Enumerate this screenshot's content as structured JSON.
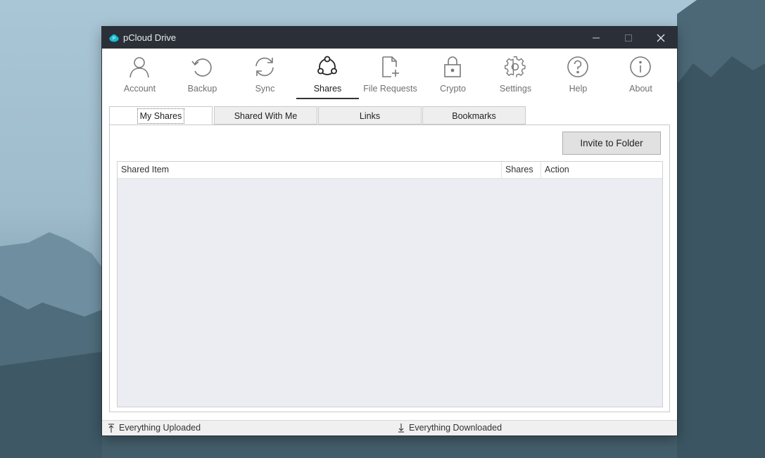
{
  "window": {
    "title": "pCloud Drive"
  },
  "toolbar": {
    "items": [
      {
        "label": "Account",
        "icon": "user-icon"
      },
      {
        "label": "Backup",
        "icon": "backup-icon"
      },
      {
        "label": "Sync",
        "icon": "sync-icon"
      },
      {
        "label": "Shares",
        "icon": "share-icon",
        "active": true
      },
      {
        "label": "File Requests",
        "icon": "file-request-icon"
      },
      {
        "label": "Crypto",
        "icon": "lock-icon"
      },
      {
        "label": "Settings",
        "icon": "gear-icon"
      },
      {
        "label": "Help",
        "icon": "help-icon"
      },
      {
        "label": "About",
        "icon": "info-icon"
      }
    ]
  },
  "tabs": [
    {
      "label": "My Shares",
      "active": true
    },
    {
      "label": "Shared With Me"
    },
    {
      "label": "Links"
    },
    {
      "label": "Bookmarks"
    }
  ],
  "panel": {
    "invite_label": "Invite to Folder",
    "columns": [
      "Shared Item",
      "Shares",
      "Action"
    ],
    "rows": []
  },
  "status": {
    "uploaded": "Everything Uploaded",
    "downloaded": "Everything Downloaded"
  },
  "colors": {
    "titlebar": "#2b3038",
    "brand": "#17bed0"
  }
}
